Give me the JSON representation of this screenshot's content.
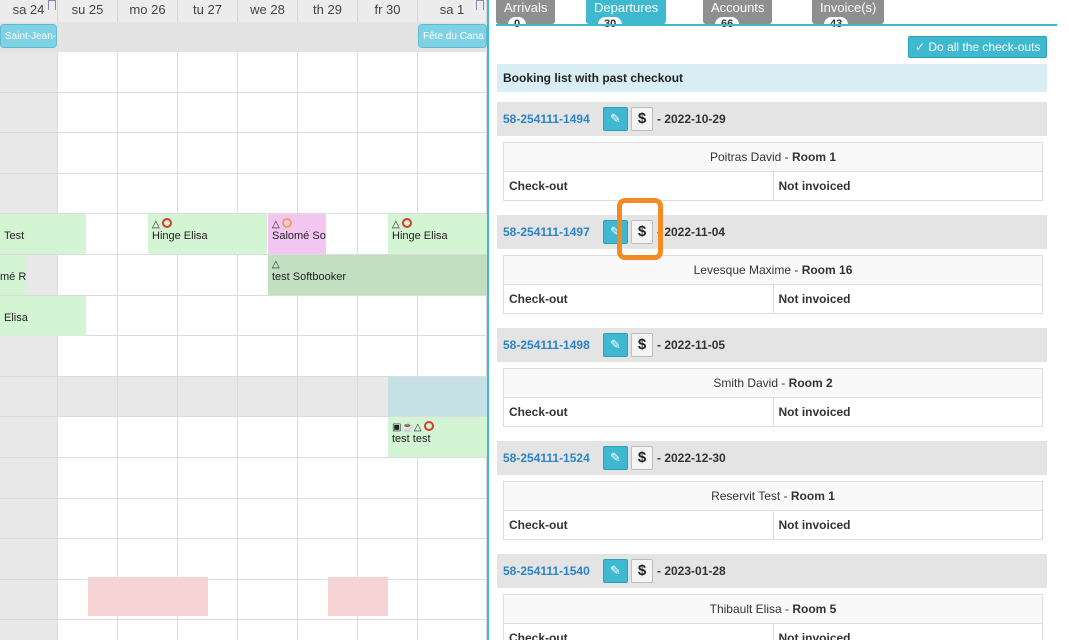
{
  "calendar": {
    "days": [
      "sa 24",
      "su 25",
      "mo 26",
      "tu 27",
      "we 28",
      "th 29",
      "fr 30",
      "sa 1"
    ],
    "holidays": [
      "Saint-Jean-",
      "Fête du Cana"
    ],
    "bookings": {
      "test": "Test",
      "hinge1": "Hinge Elisa",
      "salome": "Salomé Sof",
      "hinge2": "Hinge Elisa",
      "res": "mé Res",
      "softbooker": "test Softbooker",
      "elisa": "Elisa",
      "testtest": "test test"
    },
    "icons": {
      "hanger": "△",
      "ring": "○",
      "group": "▣☕△"
    }
  },
  "tabs": [
    {
      "label": "Arrivals",
      "count": "0"
    },
    {
      "label": "Departures",
      "count": "30"
    },
    {
      "label": "Accounts",
      "count": "66"
    },
    {
      "label": "Invoice(s)",
      "count": "43"
    }
  ],
  "actions": {
    "checkout_all": "✓ Do all the check-outs"
  },
  "section_title": "Booking list with past checkout",
  "bookings": [
    {
      "id": "58-254111-1494",
      "date": "- 2022-10-29",
      "guest": "Poitras David",
      "room": "Room 1",
      "col1": "Check-out",
      "col2": "Not invoiced"
    },
    {
      "id": "58-254111-1497",
      "date": "- 2022-11-04",
      "guest": "Levesque Maxime",
      "room": "Room 16",
      "col1": "Check-out",
      "col2": "Not invoiced"
    },
    {
      "id": "58-254111-1498",
      "date": "- 2022-11-05",
      "guest": "Smith David",
      "room": "Room 2",
      "col1": "Check-out",
      "col2": "Not invoiced"
    },
    {
      "id": "58-254111-1524",
      "date": "- 2022-12-30",
      "guest": "Reservit Test",
      "room": "Room 1",
      "col1": "Check-out",
      "col2": "Not invoiced"
    },
    {
      "id": "58-254111-1540",
      "date": "- 2023-01-28",
      "guest": "Thibault Elisa",
      "room": "Room 5",
      "col1": "Check-out",
      "col2": "Not invoiced"
    }
  ],
  "glyphs": {
    "edit": "✎",
    "dollar": "$",
    "sep": " - "
  }
}
